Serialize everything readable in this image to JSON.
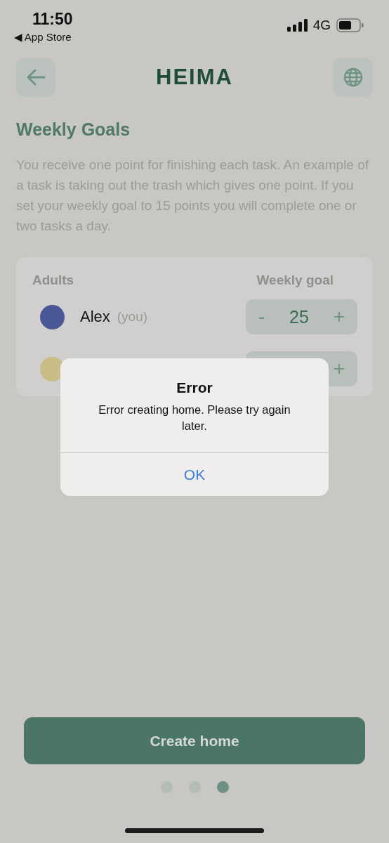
{
  "status_bar": {
    "time": "11:50",
    "back_app": "◀ App Store",
    "network": "4G"
  },
  "header": {
    "logo": "HEIMA"
  },
  "title": "Weekly Goals",
  "description": "You receive one point for finishing each task. An example of a task is taking out the trash which gives one point. If you set your weekly goal to 15 points you will complete one or two tasks a day.",
  "table": {
    "columns": [
      "Adults",
      "Weekly goal"
    ],
    "rows": [
      {
        "color": "#4a5797",
        "name": "Alex",
        "note": "(you)",
        "decrement": "-",
        "value": "25",
        "increment": "+"
      },
      {
        "color": "#c9bd87",
        "increment": "+"
      }
    ]
  },
  "alert": {
    "title": "Error",
    "message": "Error creating home. Please try again later.",
    "button": "OK"
  },
  "primary_button": "Create home",
  "pager": [
    {
      "selected": false
    },
    {
      "selected": false
    },
    {
      "selected": true
    }
  ]
}
